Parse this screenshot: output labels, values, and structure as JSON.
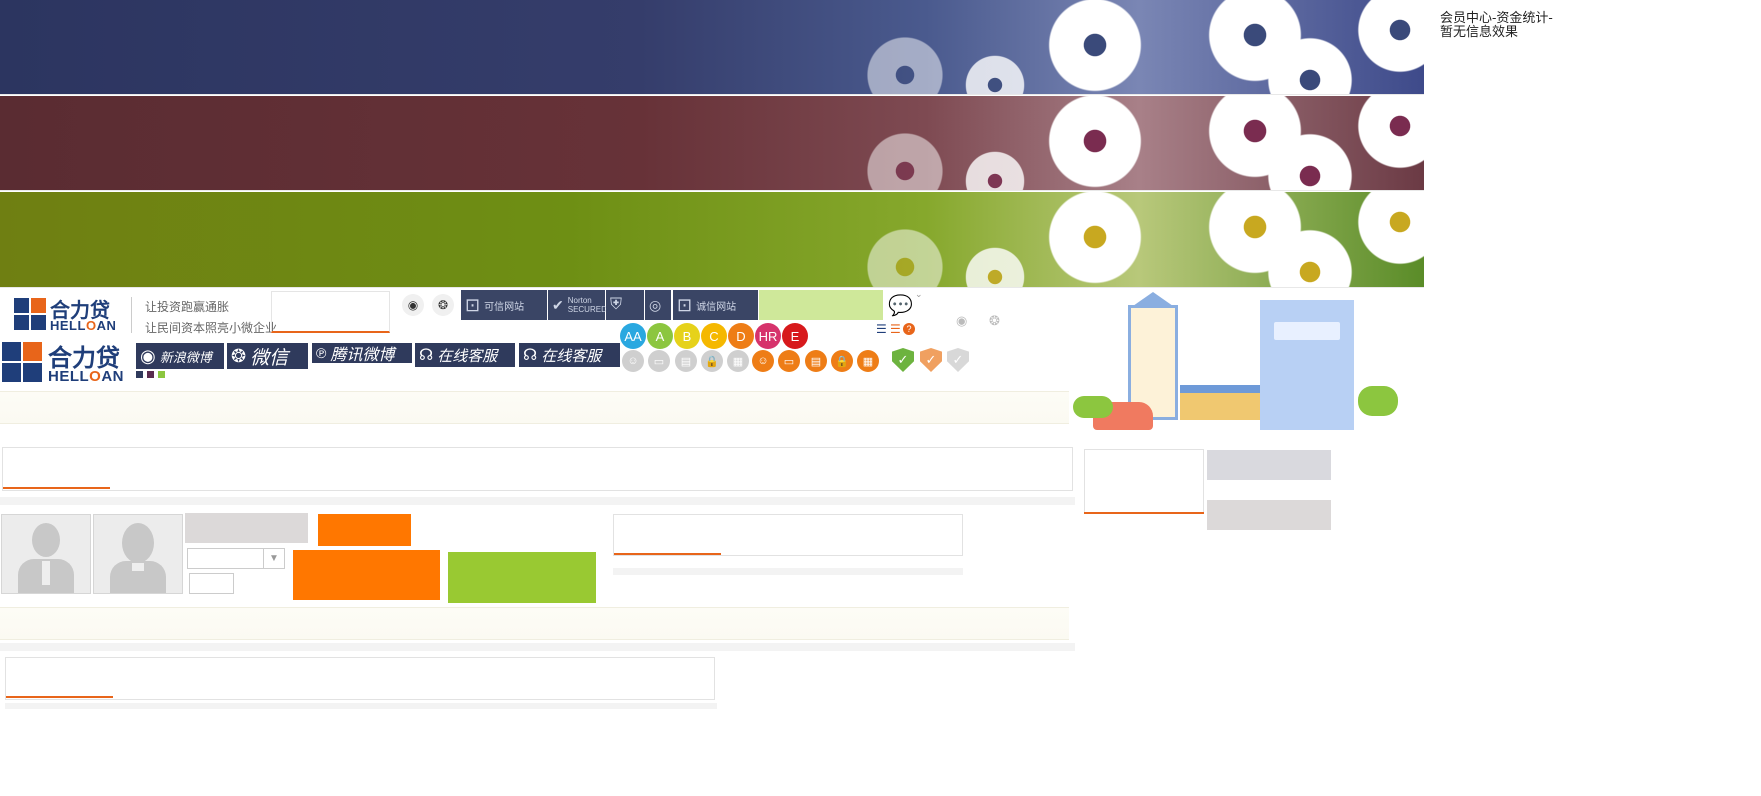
{
  "page": {
    "corner_text_line1": "会员中心-资金统计-",
    "corner_text_line2": "暂无信息效果"
  },
  "header": {
    "logo_cn": "合力贷",
    "logo_en_a": "HELL",
    "logo_en_o": "O",
    "logo_en_b": "AN",
    "slogan_1": "让投资跑赢通胀",
    "slogan_2": "让民间资本照亮小微企业"
  },
  "badges": {
    "b1": "可信网站",
    "b2": "Norton SECURED",
    "b3": "诚信网站"
  },
  "social": {
    "weibo": "新浪微博",
    "wechat": "微信",
    "tencent": "腾讯微博",
    "service1": "在线客服",
    "service2": "在线客服"
  },
  "ratings": [
    "AA",
    "A",
    "B",
    "C",
    "D",
    "HR",
    "E"
  ],
  "rating_colors": [
    "#2aa8e0",
    "#8cc63f",
    "#e6d21a",
    "#f5b800",
    "#ee7d16",
    "#d6336c",
    "#d7191c"
  ],
  "icons": {
    "gray": [
      "user-icon",
      "card-icon",
      "card-icon",
      "lock-icon",
      "grid-icon"
    ],
    "orange": [
      "user-icon",
      "card-icon",
      "card-icon",
      "lock-icon",
      "grid-icon"
    ]
  },
  "colors": {
    "accent_orange": "#ff7700",
    "accent_green": "#99c932",
    "brand_blue": "#1f3e7a"
  }
}
